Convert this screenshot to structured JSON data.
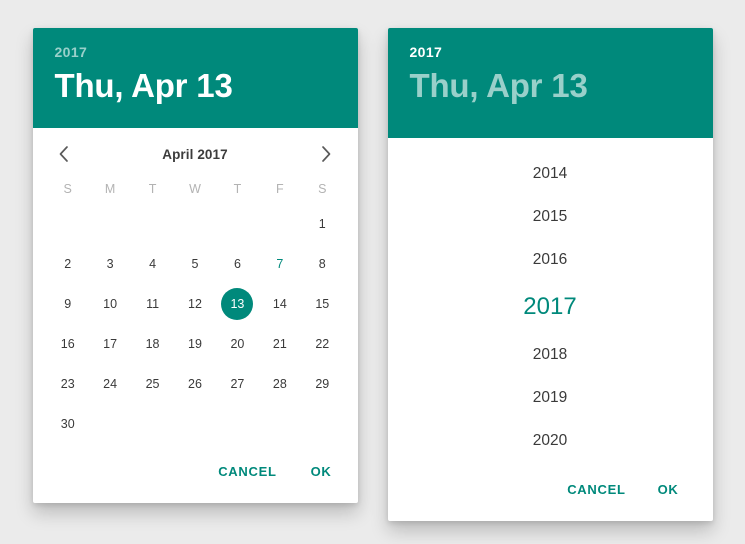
{
  "background_color": "#ebebeb",
  "accent_color": "#00897B",
  "date_picker": {
    "header": {
      "year": "2017",
      "date": "Thu, Apr 13"
    },
    "nav": {
      "prev_icon": "chevron-left-icon",
      "next_icon": "chevron-right-icon",
      "month_label": "April 2017"
    },
    "weekdays": [
      "S",
      "M",
      "T",
      "W",
      "T",
      "F",
      "S"
    ],
    "weeks": [
      [
        "",
        "",
        "",
        "",
        "",
        "",
        "1"
      ],
      [
        "2",
        "3",
        "4",
        "5",
        "6",
        "7",
        "8"
      ],
      [
        "9",
        "10",
        "11",
        "12",
        "13",
        "14",
        "15"
      ],
      [
        "16",
        "17",
        "18",
        "19",
        "20",
        "21",
        "22"
      ],
      [
        "23",
        "24",
        "25",
        "26",
        "27",
        "28",
        "29"
      ],
      [
        "30",
        "",
        "",
        "",
        "",
        "",
        ""
      ]
    ],
    "selected_day": "13",
    "today_day": "7",
    "actions": {
      "cancel": "CANCEL",
      "ok": "OK"
    }
  },
  "year_picker": {
    "header": {
      "year": "2017",
      "date": "Thu, Apr 13"
    },
    "years": [
      "2014",
      "2015",
      "2016",
      "2017",
      "2018",
      "2019",
      "2020"
    ],
    "selected_year": "2017",
    "actions": {
      "cancel": "CANCEL",
      "ok": "OK"
    }
  }
}
